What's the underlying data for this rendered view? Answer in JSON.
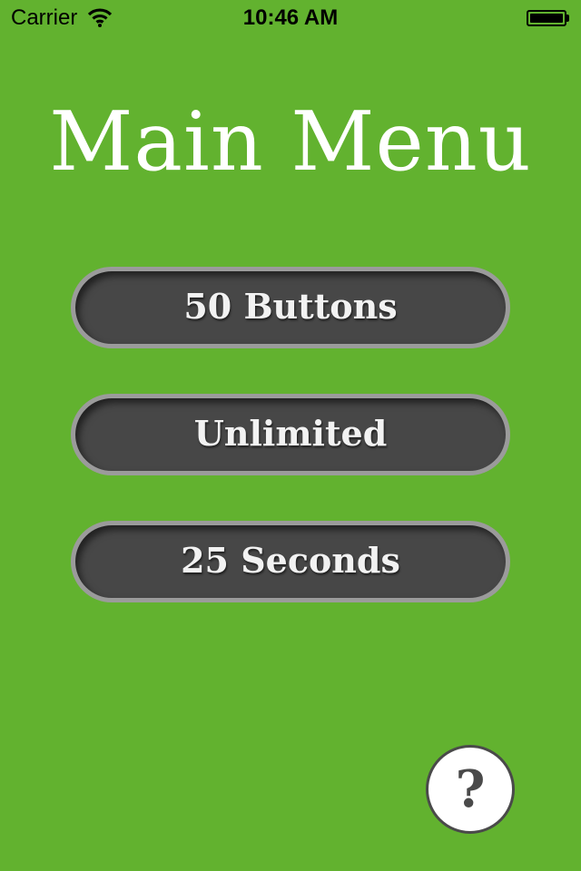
{
  "status_bar": {
    "carrier": "Carrier",
    "time": "10:46 AM",
    "wifi_icon": "wifi-icon",
    "battery_icon": "battery-icon"
  },
  "title": "Main Menu",
  "menu": {
    "buttons": [
      {
        "label": "50 Buttons"
      },
      {
        "label": "Unlimited"
      },
      {
        "label": "25 Seconds"
      }
    ]
  },
  "help": {
    "label": "?",
    "icon": "question-icon"
  },
  "colors": {
    "background": "#62b22f",
    "button_fill": "#474747",
    "button_border": "#9b9b9b",
    "text": "#ffffff"
  }
}
